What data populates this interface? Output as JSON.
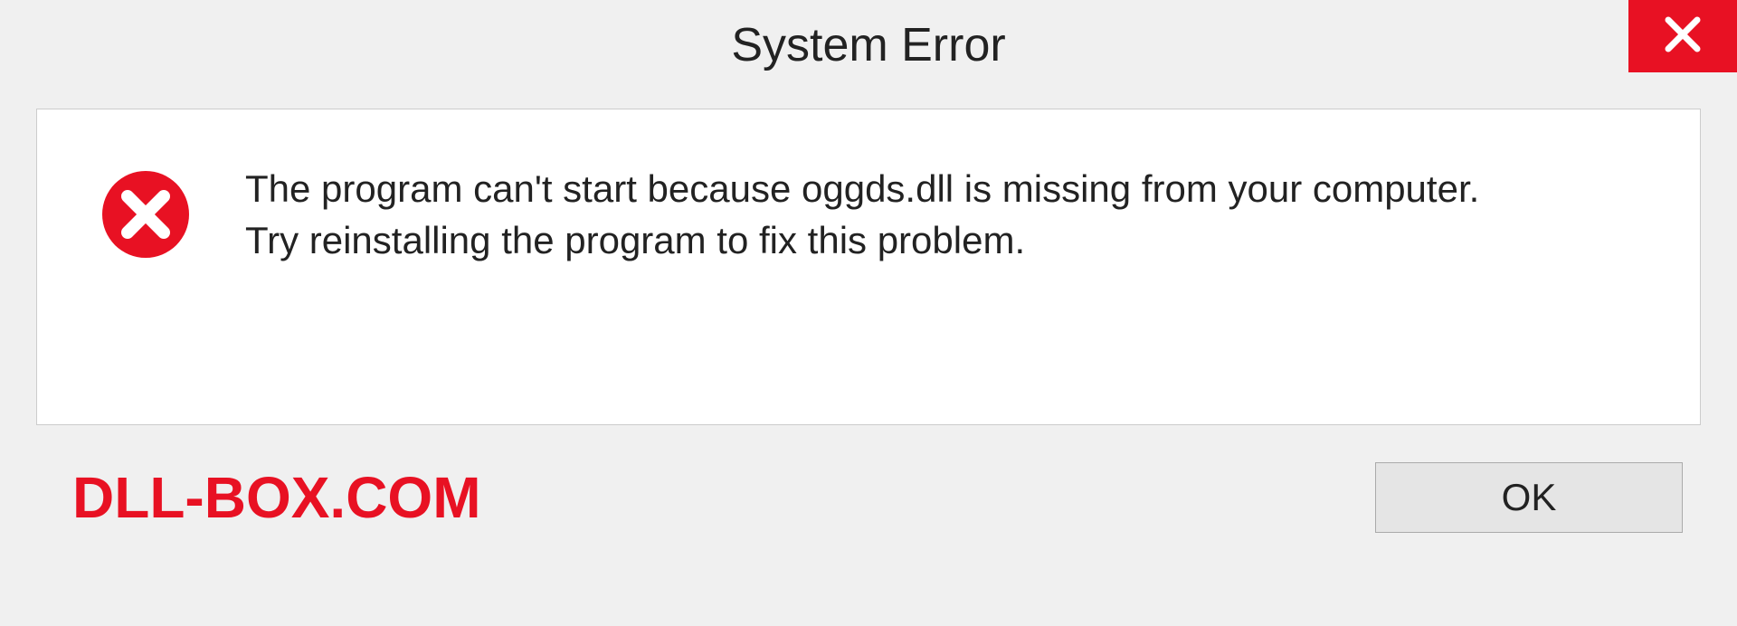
{
  "dialog": {
    "title": "System Error",
    "message_line1": "The program can't start because oggds.dll is missing from your computer.",
    "message_line2": "Try reinstalling the program to fix this problem.",
    "ok_label": "OK"
  },
  "watermark": "DLL-BOX.COM",
  "colors": {
    "accent_red": "#e81123",
    "bg": "#f0f0f0",
    "panel": "#ffffff"
  }
}
